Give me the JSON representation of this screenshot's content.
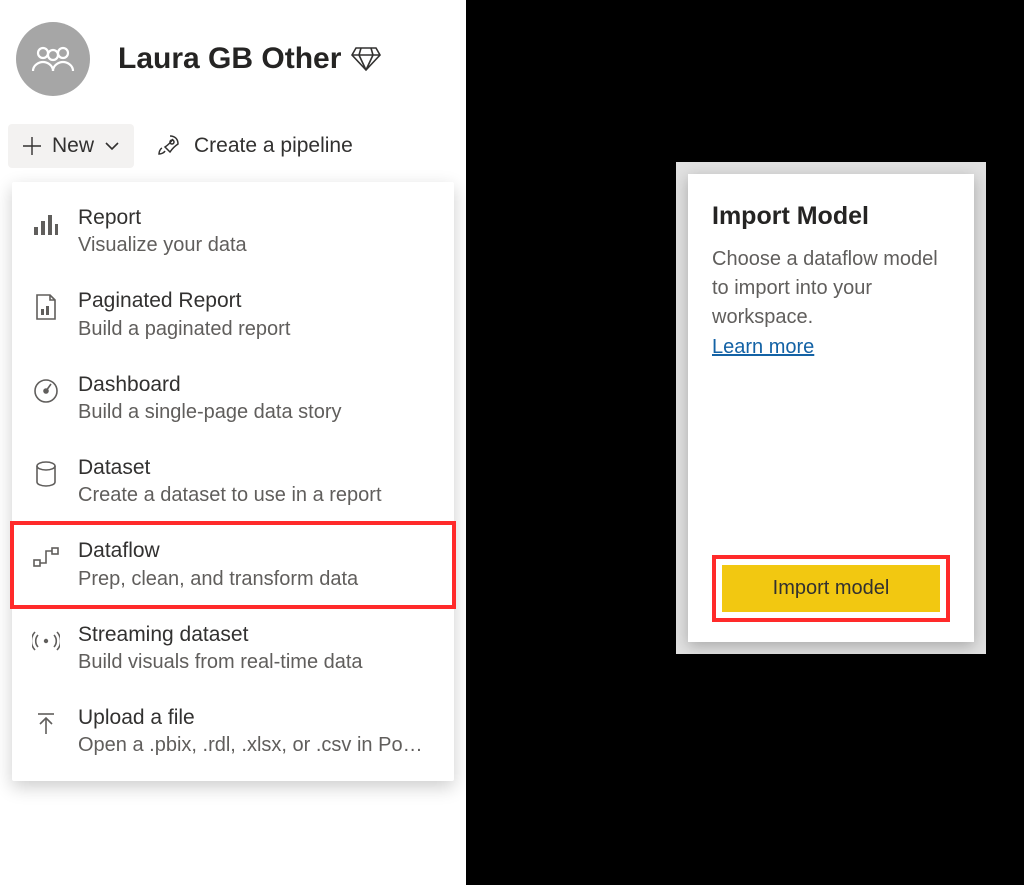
{
  "workspace": {
    "title": "Laura GB Other"
  },
  "toolbar": {
    "new_label": "New",
    "pipeline_label": "Create a pipeline"
  },
  "menu": {
    "items": [
      {
        "title": "Report",
        "desc": "Visualize your data"
      },
      {
        "title": "Paginated Report",
        "desc": "Build a paginated report"
      },
      {
        "title": "Dashboard",
        "desc": "Build a single-page data story"
      },
      {
        "title": "Dataset",
        "desc": "Create a dataset to use in a report"
      },
      {
        "title": "Dataflow",
        "desc": "Prep, clean, and transform data"
      },
      {
        "title": "Streaming dataset",
        "desc": "Build visuals from real-time data"
      },
      {
        "title": "Upload a file",
        "desc": "Open a .pbix, .rdl, .xlsx, or .csv in Po…"
      }
    ]
  },
  "card": {
    "title": "Import Model",
    "desc": "Choose a dataflow model to import into your workspace.",
    "link": "Learn more",
    "button": "Import model"
  }
}
